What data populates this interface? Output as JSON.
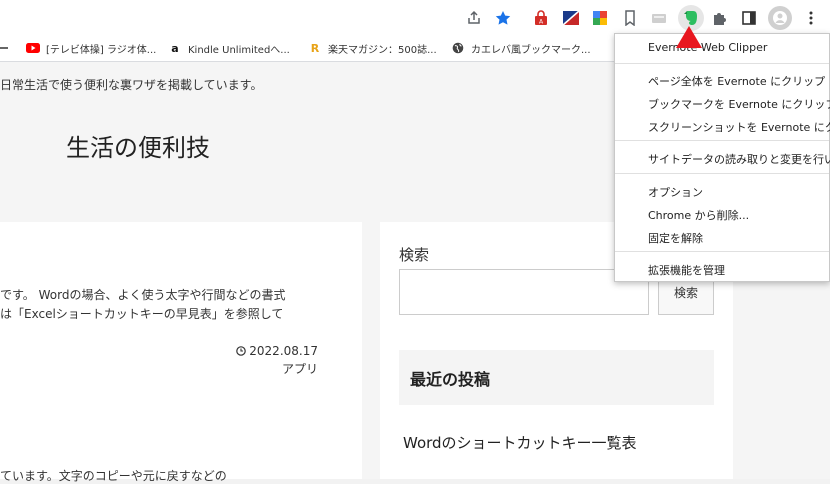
{
  "toolbar": {
    "icons": [
      "share-icon",
      "star-icon",
      "extension-lastpass-icon",
      "extension-flag-icon",
      "extension-translate-icon",
      "bookmark-icon",
      "extension-gray-icon",
      "evernote-icon",
      "puzzle-icon",
      "sidepanel-icon",
      "profile-avatar",
      "kebab-menu-icon"
    ],
    "accent": "#1a73e8"
  },
  "bookmarks": [
    {
      "label": "[テレビ体操] ラジオ体...",
      "icon": "youtube-icon"
    },
    {
      "label": "Kindle Unlimitedへ...",
      "icon": "amazon-icon"
    },
    {
      "label": "楽天マガジン：500誌...",
      "icon": "rakuten-icon"
    },
    {
      "label": "カエレバ風ブックマーク...",
      "icon": "globe-icon"
    }
  ],
  "page": {
    "tagline": "日常生活で使う便利な裏ワザを掲載しています。",
    "site_title": "生活の便利技",
    "excerpt_line1": "です。 Wordの場合、よく使う太字や行間などの書式",
    "excerpt_line2": "は「Excelショートカットキーの早見表」を参照して",
    "date": "2022.08.17",
    "category": "アプリ",
    "excerpt_bottom": "ています。文字のコピーや元に戻すなどの"
  },
  "sidebar": {
    "search_label": "検索",
    "search_button": "検索",
    "search_value": "",
    "recent_title": "最近の投稿",
    "recent_item": "Wordのショートカットキー一覧表"
  },
  "menu": {
    "header": "Evernote Web Clipper",
    "clip_page": "ページ全体を Evernote にクリップ",
    "clip_bookmark": "ブックマークを Evernote にクリップ",
    "clip_screenshot": "スクリーンショットを Evernote にクリップ",
    "site_data": "サイトデータの読み取りと変更を行います",
    "options": "オプション",
    "remove": "Chrome から削除...",
    "unpin": "固定を解除",
    "manage": "拡張機能を管理"
  },
  "colors": {
    "arrow": "#e8171f",
    "evernote": "#2dbe60"
  }
}
